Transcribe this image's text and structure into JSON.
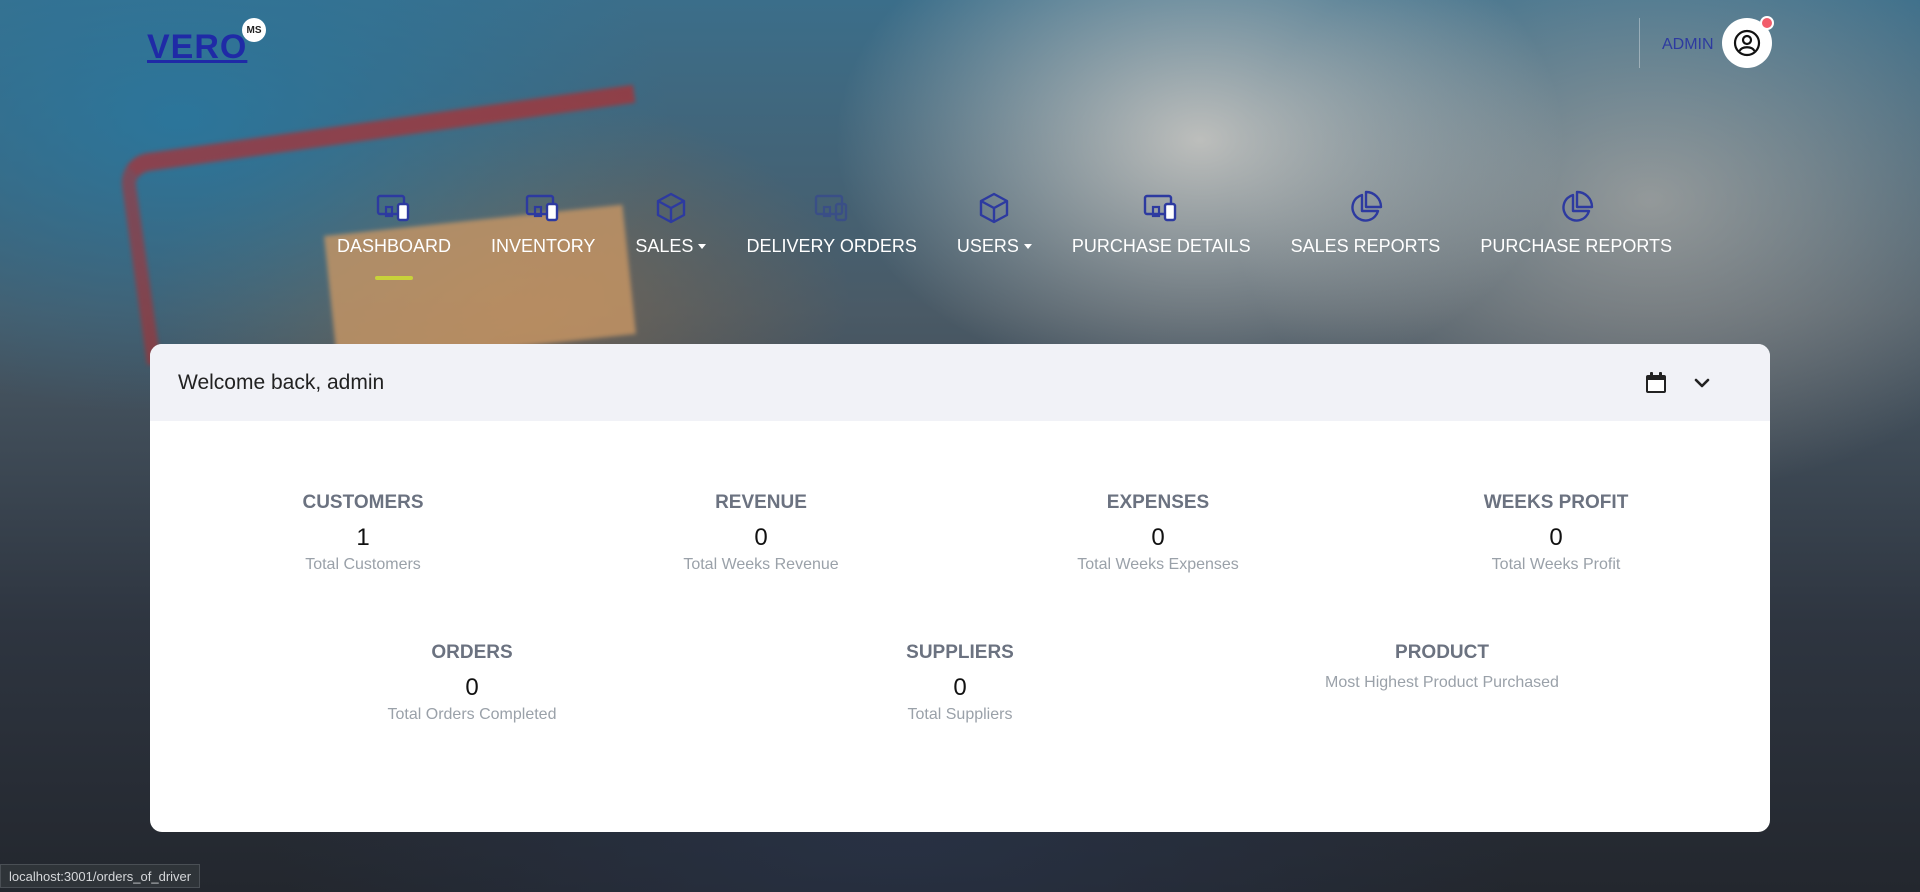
{
  "header": {
    "logo_text": "VERO",
    "logo_badge": "MS",
    "admin_label": "ADMIN"
  },
  "nav": {
    "items": [
      {
        "label": "DASHBOARD",
        "icon": "devices-icon",
        "active": true,
        "dropdown": false
      },
      {
        "label": "INVENTORY",
        "icon": "devices-icon",
        "active": false,
        "dropdown": false
      },
      {
        "label": "SALES",
        "icon": "box-icon",
        "active": false,
        "dropdown": true
      },
      {
        "label": "DELIVERY ORDERS",
        "icon": "devices-icon",
        "active": false,
        "dropdown": false
      },
      {
        "label": "USERS",
        "icon": "box-icon",
        "active": false,
        "dropdown": true
      },
      {
        "label": "PURCHASE DETAILS",
        "icon": "devices-icon",
        "active": false,
        "dropdown": false
      },
      {
        "label": "SALES REPORTS",
        "icon": "pie-chart-icon",
        "active": false,
        "dropdown": false
      },
      {
        "label": "PURCHASE REPORTS",
        "icon": "pie-chart-icon",
        "active": false,
        "dropdown": false
      }
    ]
  },
  "card": {
    "welcome": "Welcome back, admin"
  },
  "stats": {
    "customers": {
      "title": "CUSTOMERS",
      "value": "1",
      "sub": "Total Customers"
    },
    "revenue": {
      "title": "REVENUE",
      "value": "0",
      "sub": "Total Weeks Revenue"
    },
    "expenses": {
      "title": "EXPENSES",
      "value": "0",
      "sub": "Total Weeks Expenses"
    },
    "weeks_profit": {
      "title": "WEEKS PROFIT",
      "value": "0",
      "sub": "Total Weeks Profit"
    },
    "orders": {
      "title": "ORDERS",
      "value": "0",
      "sub": "Total Orders Completed"
    },
    "suppliers": {
      "title": "SUPPLIERS",
      "value": "0",
      "sub": "Total Suppliers"
    },
    "product": {
      "title": "PRODUCT",
      "value": "",
      "sub": "Most Highest Product Purchased"
    }
  },
  "status_bar": {
    "url": "localhost:3001/orders_of_driver"
  },
  "colors": {
    "brand": "#1f2aa6",
    "nav_icon": "#2d3aa0",
    "active_indicator": "#c8d23a",
    "notification": "#f25c6a"
  }
}
